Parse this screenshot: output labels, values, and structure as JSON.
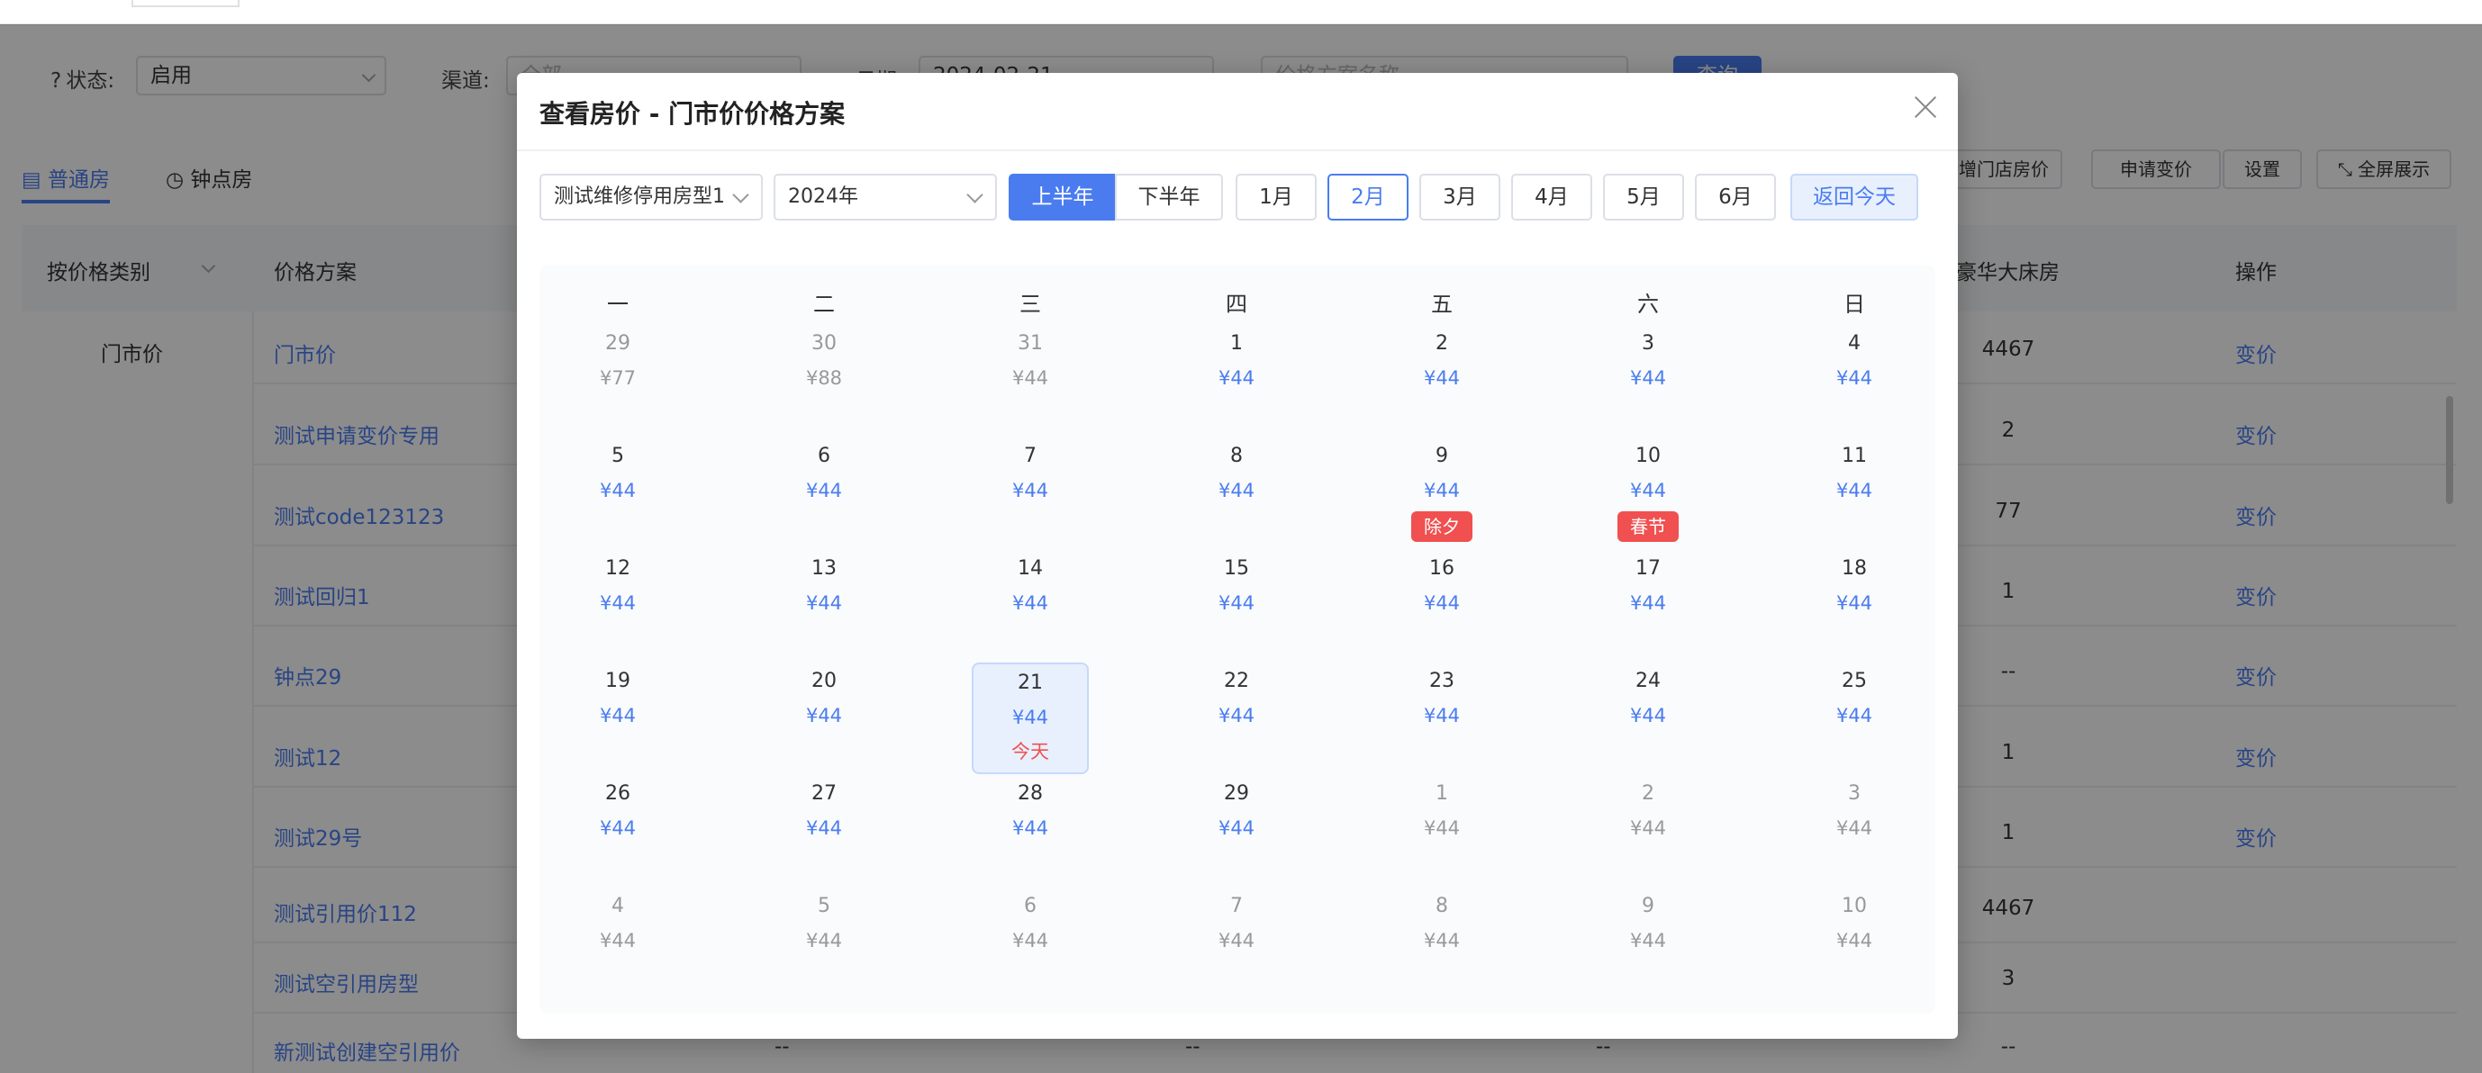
{
  "filters": {
    "status_label": "状态:",
    "status_value": "启用",
    "channel_label": "渠道:",
    "channel_placeholder": "全部",
    "date_label": "日期:",
    "date_value": "2024-02-21",
    "search_placeholder": "价格方案名称",
    "query_button": "查询"
  },
  "tabs": [
    "普通房",
    "钟点房"
  ],
  "toolbar": [
    "新增门店房价",
    "申请变价",
    "设置",
    "全屏展示"
  ],
  "table": {
    "headers": {
      "category": "按价格类别",
      "plan": "价格方案",
      "room": "豪华大床房",
      "action": "操作"
    },
    "category_value": "门市价",
    "rows": [
      {
        "plan": "门市价",
        "room": "4467",
        "action": "变价"
      },
      {
        "plan": "测试申请变价专用",
        "room": "2",
        "action": "变价"
      },
      {
        "plan": "测试code123123",
        "room": "77",
        "action": "变价"
      },
      {
        "plan": "测试回归1",
        "room": "1",
        "action": "变价"
      },
      {
        "plan": "钟点29",
        "room": "--",
        "action": "变价"
      },
      {
        "plan": "测试12",
        "room": "1",
        "action": "变价"
      },
      {
        "plan": "测试29号",
        "room": "1",
        "action": "变价"
      },
      {
        "plan": "测试引用价112",
        "room": "4467",
        "action": ""
      },
      {
        "plan": "测试空引用房型",
        "room": "3",
        "action": ""
      },
      {
        "plan": "新测试创建空引用价",
        "room": "--",
        "action": "",
        "extra": "--"
      }
    ]
  },
  "modal": {
    "title": "查看房价 - 门市价价格方案",
    "room_type": "测试维修停用房型1",
    "year": "2024年",
    "halves": [
      "上半年",
      "下半年"
    ],
    "active_half": 0,
    "months": [
      "1月",
      "2月",
      "3月",
      "4月",
      "5月",
      "6月"
    ],
    "active_month": 1,
    "today_button": "返回今天",
    "weekdays": [
      "一",
      "二",
      "三",
      "四",
      "五",
      "六",
      "日"
    ],
    "weeks": [
      [
        {
          "d": "29",
          "p": "¥77",
          "o": true
        },
        {
          "d": "30",
          "p": "¥88",
          "o": true
        },
        {
          "d": "31",
          "p": "¥44",
          "o": true
        },
        {
          "d": "1",
          "p": "¥44"
        },
        {
          "d": "2",
          "p": "¥44"
        },
        {
          "d": "3",
          "p": "¥44"
        },
        {
          "d": "4",
          "p": "¥44"
        }
      ],
      [
        {
          "d": "5",
          "p": "¥44"
        },
        {
          "d": "6",
          "p": "¥44"
        },
        {
          "d": "7",
          "p": "¥44"
        },
        {
          "d": "8",
          "p": "¥44"
        },
        {
          "d": "9",
          "p": "¥44",
          "tag": "除夕"
        },
        {
          "d": "10",
          "p": "¥44",
          "tag": "春节"
        },
        {
          "d": "11",
          "p": "¥44"
        }
      ],
      [
        {
          "d": "12",
          "p": "¥44"
        },
        {
          "d": "13",
          "p": "¥44"
        },
        {
          "d": "14",
          "p": "¥44"
        },
        {
          "d": "15",
          "p": "¥44"
        },
        {
          "d": "16",
          "p": "¥44"
        },
        {
          "d": "17",
          "p": "¥44"
        },
        {
          "d": "18",
          "p": "¥44"
        }
      ],
      [
        {
          "d": "19",
          "p": "¥44"
        },
        {
          "d": "20",
          "p": "¥44"
        },
        {
          "d": "21",
          "p": "¥44",
          "today": "今天"
        },
        {
          "d": "22",
          "p": "¥44"
        },
        {
          "d": "23",
          "p": "¥44"
        },
        {
          "d": "24",
          "p": "¥44"
        },
        {
          "d": "25",
          "p": "¥44"
        }
      ],
      [
        {
          "d": "26",
          "p": "¥44"
        },
        {
          "d": "27",
          "p": "¥44"
        },
        {
          "d": "28",
          "p": "¥44"
        },
        {
          "d": "29",
          "p": "¥44"
        },
        {
          "d": "1",
          "p": "¥44",
          "o": true
        },
        {
          "d": "2",
          "p": "¥44",
          "o": true
        },
        {
          "d": "3",
          "p": "¥44",
          "o": true
        }
      ],
      [
        {
          "d": "4",
          "p": "¥44",
          "o": true
        },
        {
          "d": "5",
          "p": "¥44",
          "o": true
        },
        {
          "d": "6",
          "p": "¥44",
          "o": true
        },
        {
          "d": "7",
          "p": "¥44",
          "o": true
        },
        {
          "d": "8",
          "p": "¥44",
          "o": true
        },
        {
          "d": "9",
          "p": "¥44",
          "o": true
        },
        {
          "d": "10",
          "p": "¥44",
          "o": true
        }
      ]
    ]
  },
  "colors": {
    "primary": "#4a7cf0",
    "holiday": "#f05050",
    "today_bg": "#e8f0fe"
  }
}
